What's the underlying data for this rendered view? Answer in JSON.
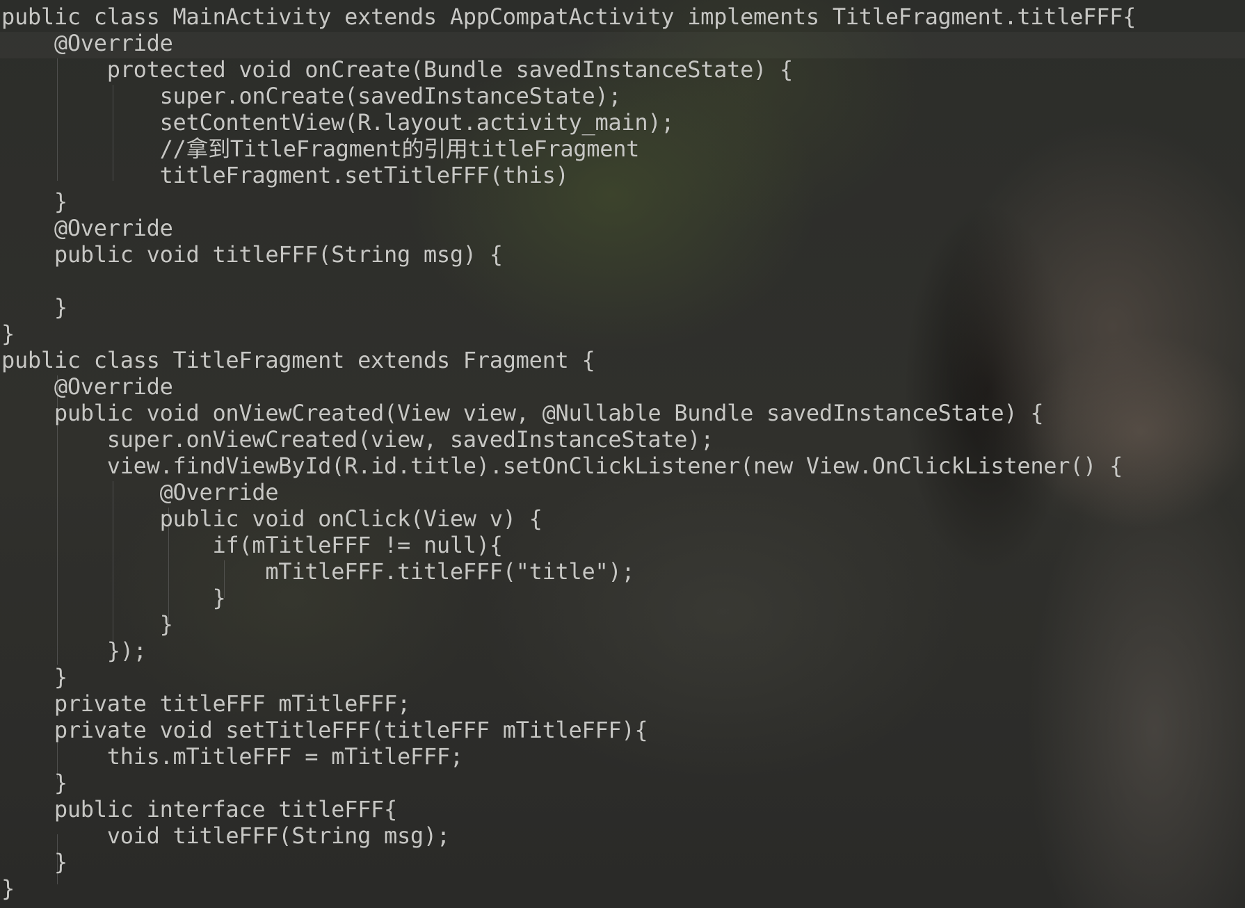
{
  "editor": {
    "text_color": "#c7c7c4",
    "lines": [
      "public class MainActivity extends AppCompatActivity implements TitleFragment.titleFFF{",
      "    @Override",
      "        protected void onCreate(Bundle savedInstanceState) {",
      "            super.onCreate(savedInstanceState);",
      "            setContentView(R.layout.activity_main);",
      "            //拿到TitleFragment的引用titleFragment",
      "            titleFragment.setTitleFFF(this)",
      "    }",
      "    @Override",
      "    public void titleFFF(String msg) {",
      "",
      "    }",
      "}",
      "public class TitleFragment extends Fragment {",
      "    @Override",
      "    public void onViewCreated(View view, @Nullable Bundle savedInstanceState) {",
      "        super.onViewCreated(view, savedInstanceState);",
      "        view.findViewById(R.id.title).setOnClickListener(new View.OnClickListener() {",
      "            @Override",
      "            public void onClick(View v) {",
      "                if(mTitleFFF != null){",
      "                    mTitleFFF.titleFFF(\"title\");",
      "                }",
      "            }",
      "        });",
      "    }",
      "    private titleFFF mTitleFFF;",
      "    private void setTitleFFF(titleFFF mTitleFFF){",
      "        this.mTitleFFF = mTitleFFF;",
      "    }",
      "    public interface titleFFF{",
      "        void titleFFF(String msg);",
      "    }",
      "}"
    ]
  }
}
